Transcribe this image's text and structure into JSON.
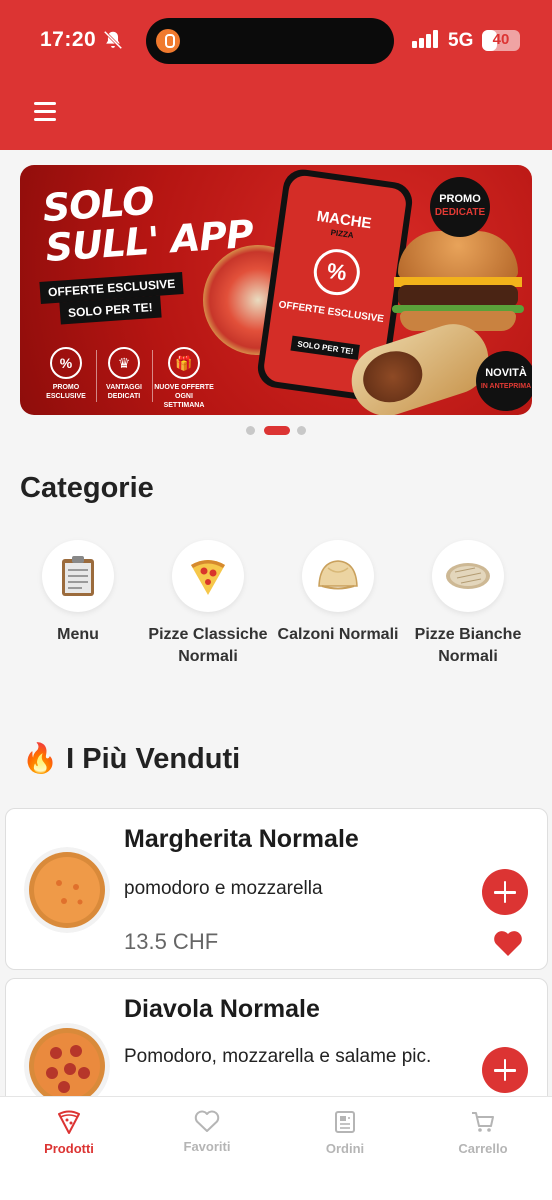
{
  "status_bar": {
    "time": "17:20",
    "network": "5G",
    "battery": "40",
    "battery_level": 0.4
  },
  "banner": {
    "headline_1": "SOLO",
    "headline_2": "SULL' APP",
    "pill_1": "OFFERTE ESCLUSIVE",
    "pill_2": "SOLO PER TE!",
    "features": [
      {
        "label": "PROMO ESCLUSIVE",
        "icon": "percent-tag-icon"
      },
      {
        "label": "VANTAGGI DEDICATI",
        "icon": "crown-icon"
      },
      {
        "label": "NUOVE OFFERTE OGNI SETTIMANA",
        "icon": "gift-icon"
      }
    ],
    "phone_brand": "MACHE",
    "phone_sub": "PIZZA",
    "phone_percent": "%",
    "phone_offer": "OFFERTE ESCLUSIVE",
    "phone_solo": "SOLO PER TE!",
    "badge_promo_1": "PROMO",
    "badge_promo_2": "DEDICATE",
    "badge_new_1": "NOVITÀ",
    "badge_new_2": "IN ANTEPRIMA",
    "pager_total": 3,
    "pager_active": 2
  },
  "categories": {
    "title": "Categorie",
    "items": [
      {
        "label": "Menu",
        "icon": "clipboard-icon"
      },
      {
        "label": "Pizze Classiche Normali",
        "icon": "pizza-slice-icon"
      },
      {
        "label": "Calzoni Normali",
        "icon": "calzone-icon"
      },
      {
        "label": "Pizze Bianche Normali",
        "icon": "white-pizza-icon"
      }
    ]
  },
  "bestsellers": {
    "emoji": "🔥",
    "title": "I Più Venduti",
    "products": [
      {
        "name": "Margherita Normale",
        "description": "pomodoro e mozzarella",
        "price": "13.5 CHF",
        "favorite": true
      },
      {
        "name": "Diavola Normale",
        "description": "Pomodoro, mozzarella e salame pic.",
        "price": "",
        "favorite": false
      }
    ]
  },
  "tabbar": {
    "tabs": [
      {
        "label": "Prodotti",
        "active": true
      },
      {
        "label": "Favoriti",
        "active": false
      },
      {
        "label": "Ordini",
        "active": false
      },
      {
        "label": "Carrello",
        "active": false
      }
    ]
  },
  "colors": {
    "brand_red": "#dc3433",
    "inactive_gray": "#b5b5b5"
  }
}
